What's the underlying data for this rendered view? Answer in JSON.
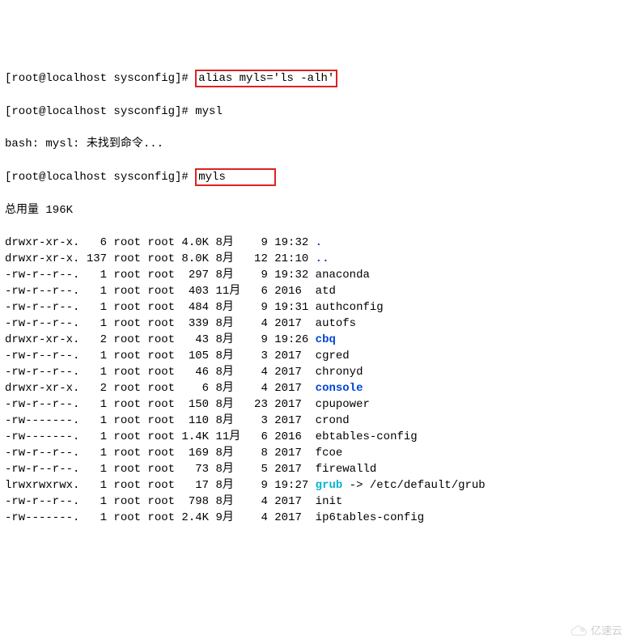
{
  "prompt1_prefix": "[root@localhost sysconfig]# ",
  "prompt1_cmd": "alias myls='ls -alh'",
  "prompt2_prefix": "[root@localhost sysconfig]# ",
  "prompt2_cmd": "mysl",
  "bash_err": "bash: mysl: 未找到命令...",
  "prompt3_prefix": "[root@localhost sysconfig]# ",
  "prompt3_cmd": "myls",
  "total_line": "总用量 196K",
  "rows": [
    {
      "perm": "drwxr-xr-x.",
      "nl": "  6",
      "own": "root",
      "grp": "root",
      "size": "4.0K",
      "mon": "8月 ",
      "day": " 9",
      "time": "19:32",
      "name": ".",
      "cls": "blue"
    },
    {
      "perm": "drwxr-xr-x.",
      "nl": "137",
      "own": "root",
      "grp": "root",
      "size": "8.0K",
      "mon": "8月 ",
      "day": "12",
      "time": "21:10",
      "name": "..",
      "cls": "blue"
    },
    {
      "perm": "-rw-r--r--.",
      "nl": "  1",
      "own": "root",
      "grp": "root",
      "size": " 297",
      "mon": "8月 ",
      "day": " 9",
      "time": "19:32",
      "name": "anaconda",
      "cls": ""
    },
    {
      "perm": "-rw-r--r--.",
      "nl": "  1",
      "own": "root",
      "grp": "root",
      "size": " 403",
      "mon": "11月",
      "day": " 6",
      "time": "2016 ",
      "name": "atd",
      "cls": ""
    },
    {
      "perm": "-rw-r--r--.",
      "nl": "  1",
      "own": "root",
      "grp": "root",
      "size": " 484",
      "mon": "8月 ",
      "day": " 9",
      "time": "19:31",
      "name": "authconfig",
      "cls": ""
    },
    {
      "perm": "-rw-r--r--.",
      "nl": "  1",
      "own": "root",
      "grp": "root",
      "size": " 339",
      "mon": "8月 ",
      "day": " 4",
      "time": "2017 ",
      "name": "autofs",
      "cls": ""
    },
    {
      "perm": "drwxr-xr-x.",
      "nl": "  2",
      "own": "root",
      "grp": "root",
      "size": "  43",
      "mon": "8月 ",
      "day": " 9",
      "time": "19:26",
      "name": "cbq",
      "cls": "blue"
    },
    {
      "perm": "-rw-r--r--.",
      "nl": "  1",
      "own": "root",
      "grp": "root",
      "size": " 105",
      "mon": "8月 ",
      "day": " 3",
      "time": "2017 ",
      "name": "cgred",
      "cls": ""
    },
    {
      "perm": "-rw-r--r--.",
      "nl": "  1",
      "own": "root",
      "grp": "root",
      "size": "  46",
      "mon": "8月 ",
      "day": " 4",
      "time": "2017 ",
      "name": "chronyd",
      "cls": ""
    },
    {
      "perm": "drwxr-xr-x.",
      "nl": "  2",
      "own": "root",
      "grp": "root",
      "size": "   6",
      "mon": "8月 ",
      "day": " 4",
      "time": "2017 ",
      "name": "console",
      "cls": "blue"
    },
    {
      "perm": "-rw-r--r--.",
      "nl": "  1",
      "own": "root",
      "grp": "root",
      "size": " 150",
      "mon": "8月 ",
      "day": "23",
      "time": "2017 ",
      "name": "cpupower",
      "cls": ""
    },
    {
      "perm": "-rw-------.",
      "nl": "  1",
      "own": "root",
      "grp": "root",
      "size": " 110",
      "mon": "8月 ",
      "day": " 3",
      "time": "2017 ",
      "name": "crond",
      "cls": ""
    },
    {
      "perm": "-rw-------.",
      "nl": "  1",
      "own": "root",
      "grp": "root",
      "size": "1.4K",
      "mon": "11月",
      "day": " 6",
      "time": "2016 ",
      "name": "ebtables-config",
      "cls": ""
    },
    {
      "perm": "-rw-r--r--.",
      "nl": "  1",
      "own": "root",
      "grp": "root",
      "size": " 169",
      "mon": "8月 ",
      "day": " 8",
      "time": "2017 ",
      "name": "fcoe",
      "cls": ""
    },
    {
      "perm": "-rw-r--r--.",
      "nl": "  1",
      "own": "root",
      "grp": "root",
      "size": "  73",
      "mon": "8月 ",
      "day": " 5",
      "time": "2017 ",
      "name": "firewalld",
      "cls": ""
    },
    {
      "perm": "lrwxrwxrwx.",
      "nl": "  1",
      "own": "root",
      "grp": "root",
      "size": "  17",
      "mon": "8月 ",
      "day": " 9",
      "time": "19:27",
      "name": "grub",
      "cls": "cyan",
      "link": " -> /etc/default/grub"
    },
    {
      "perm": "-rw-r--r--.",
      "nl": "  1",
      "own": "root",
      "grp": "root",
      "size": " 798",
      "mon": "8月 ",
      "day": " 4",
      "time": "2017 ",
      "name": "init",
      "cls": ""
    },
    {
      "perm": "-rw-------.",
      "nl": "  1",
      "own": "root",
      "grp": "root",
      "size": "2.4K",
      "mon": "9月 ",
      "day": " 4",
      "time": "2017 ",
      "name": "ip6tables-config",
      "cls": ""
    }
  ],
  "watermark": "亿速云"
}
